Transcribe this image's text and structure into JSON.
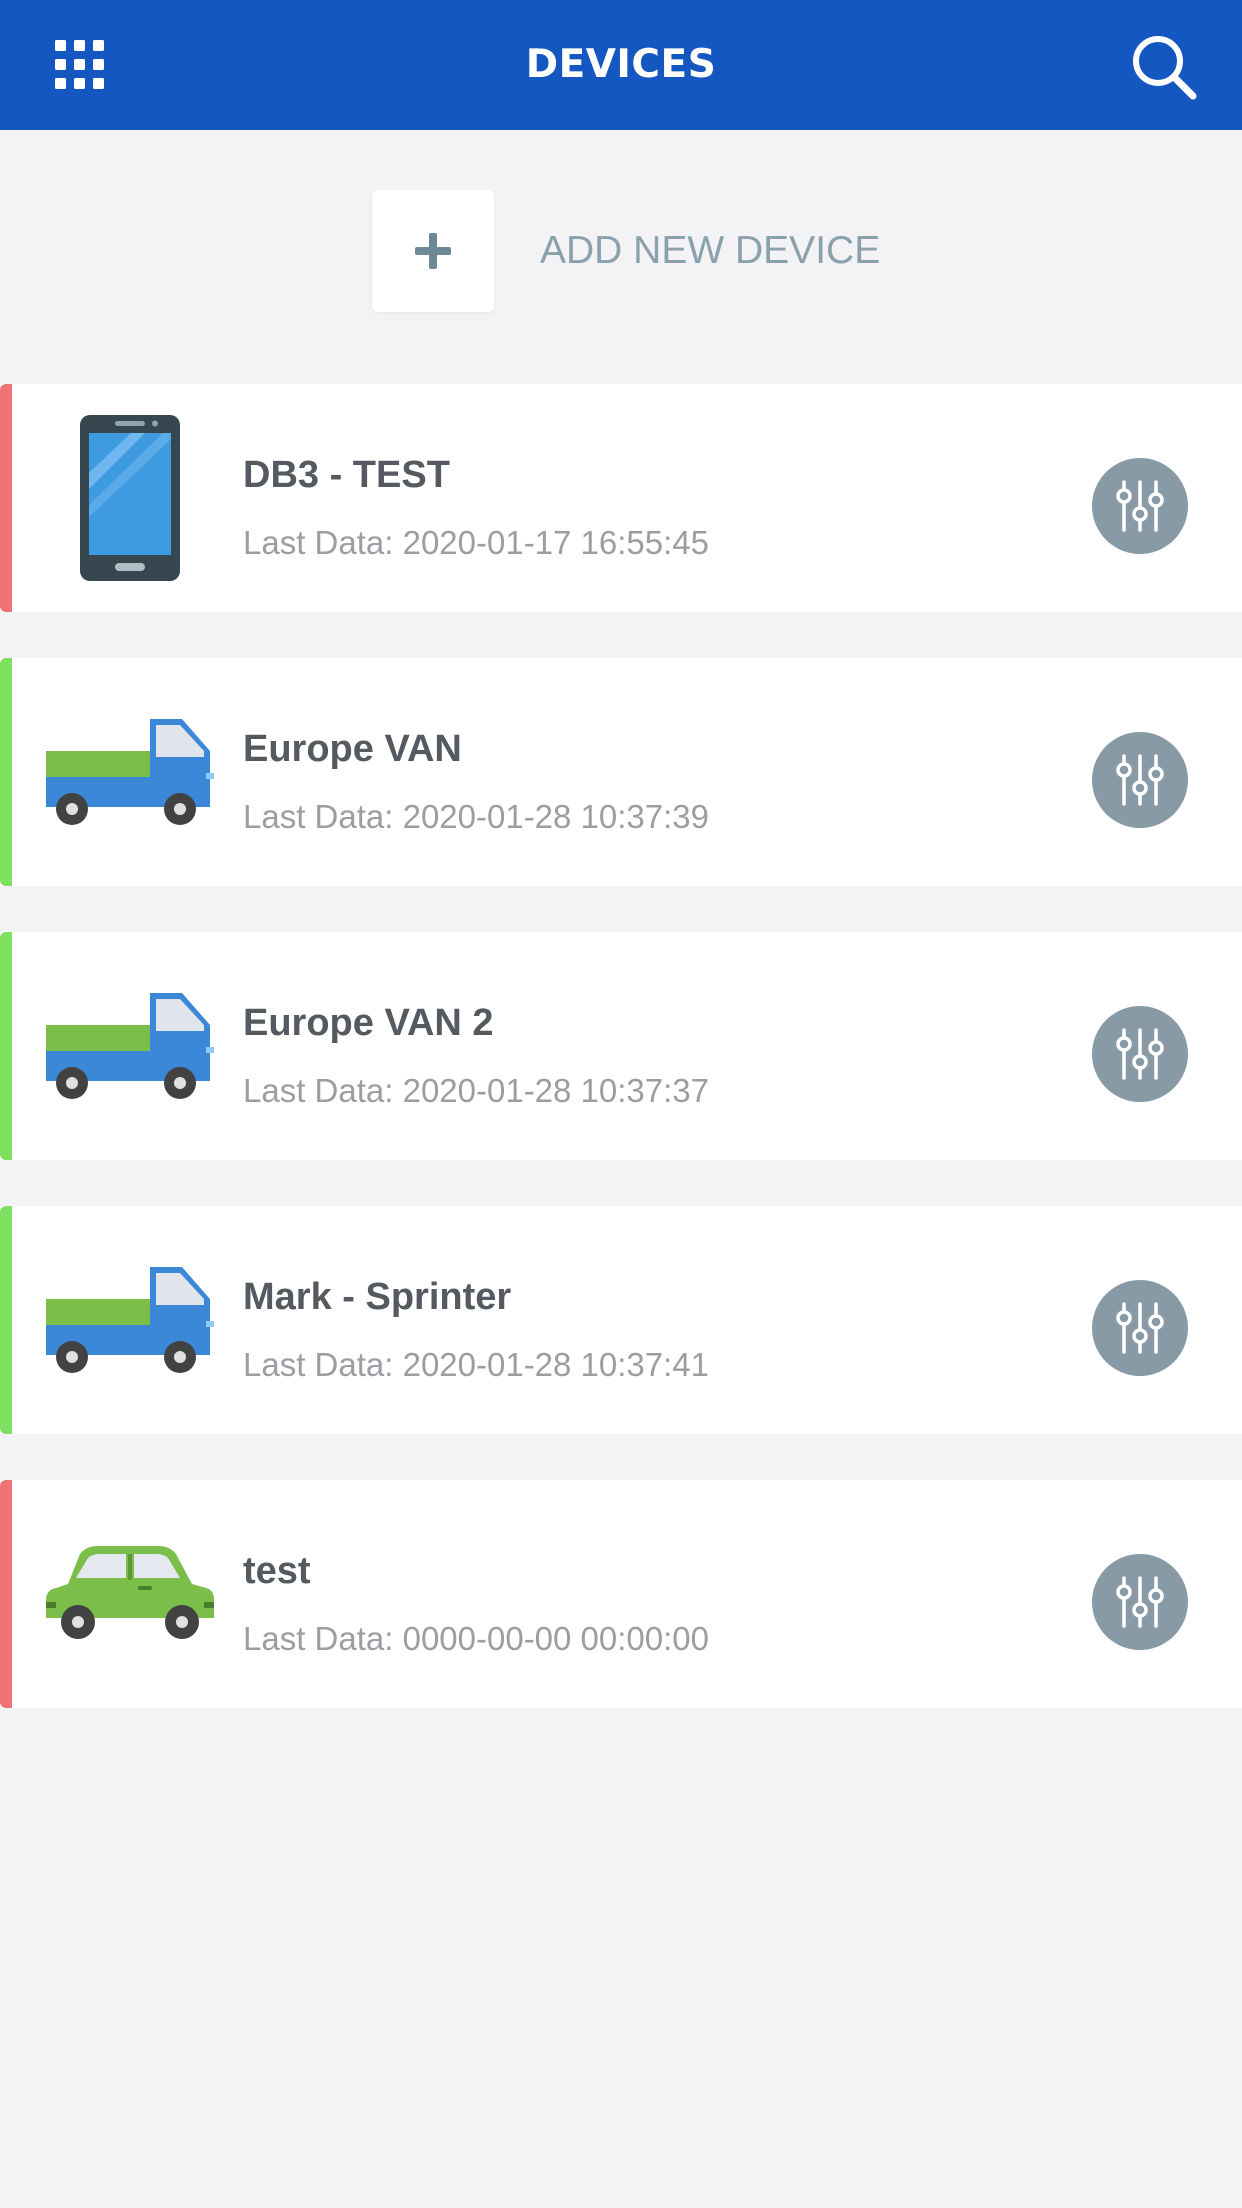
{
  "header": {
    "title": "DEVICES",
    "background": "#1457c0",
    "menu_icon": "grid-icon",
    "search_icon": "search-icon"
  },
  "add_device": {
    "label": "ADD NEW DEVICE",
    "icon": "plus-icon"
  },
  "status_colors": {
    "offline": "#f07373",
    "online": "#7ee05f"
  },
  "devices": [
    {
      "name": "DB3 - TEST",
      "last_data": "Last Data: 2020-01-17 16:55:45",
      "status": "offline",
      "icon": "smartphone-icon"
    },
    {
      "name": "Europe VAN",
      "last_data": "Last Data: 2020-01-28 10:37:39",
      "status": "online",
      "icon": "truck-icon"
    },
    {
      "name": "Europe VAN 2",
      "last_data": "Last Data: 2020-01-28 10:37:37",
      "status": "online",
      "icon": "truck-icon"
    },
    {
      "name": "Mark - Sprinter",
      "last_data": "Last Data: 2020-01-28 10:37:41",
      "status": "online",
      "icon": "truck-icon"
    },
    {
      "name": "test",
      "last_data": "Last Data: 0000-00-00 00:00:00",
      "status": "offline",
      "icon": "car-icon"
    }
  ],
  "action_icon": "sensors-icon"
}
